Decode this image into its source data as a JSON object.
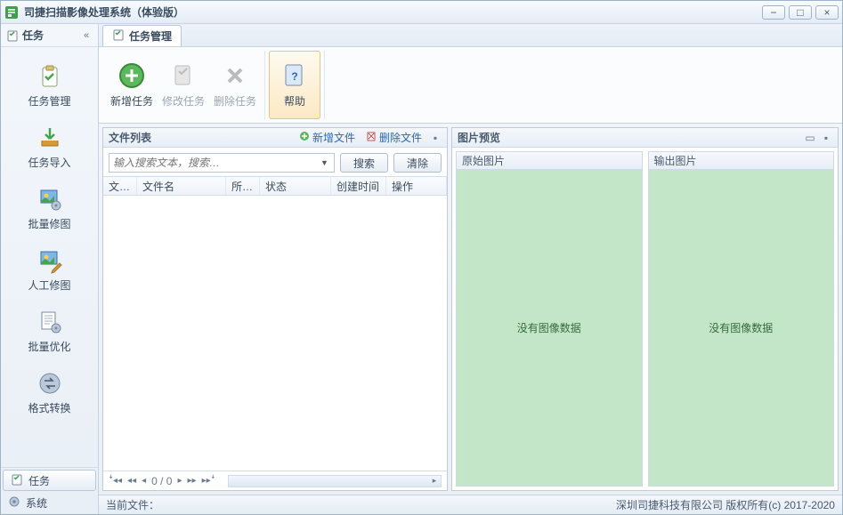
{
  "app": {
    "title": "司捷扫描影像处理系统（体验版）"
  },
  "winbtns": {
    "min": "−",
    "max": "□",
    "close": "×"
  },
  "sidebar": {
    "header": "任务",
    "collapse": "«",
    "items": [
      {
        "label": "任务管理"
      },
      {
        "label": "任务导入"
      },
      {
        "label": "批量修图"
      },
      {
        "label": "人工修图"
      },
      {
        "label": "批量优化"
      },
      {
        "label": "格式转换"
      }
    ],
    "footer": [
      {
        "label": "任务"
      },
      {
        "label": "系统"
      }
    ]
  },
  "tab": {
    "label": "任务管理"
  },
  "ribbon": {
    "new": "新增任务",
    "edit": "修改任务",
    "del": "删除任务",
    "help": "帮助"
  },
  "filelist": {
    "title": "文件列表",
    "add": "新增文件",
    "remove": "删除文件",
    "search_placeholder": "输入搜索文本，搜索…",
    "search_btn": "搜索",
    "clear_btn": "清除",
    "cols": [
      "文…",
      "文件名",
      "所…",
      "状态",
      "创建时间",
      "操作"
    ],
    "pager": "0 / 0"
  },
  "preview": {
    "title": "图片预览",
    "orig": "原始图片",
    "out": "输出图片",
    "empty": "没有图像数据"
  },
  "status": {
    "current": "当前文件：",
    "copyright": "深圳司捷科技有限公司 版权所有(c) 2017-2020"
  }
}
